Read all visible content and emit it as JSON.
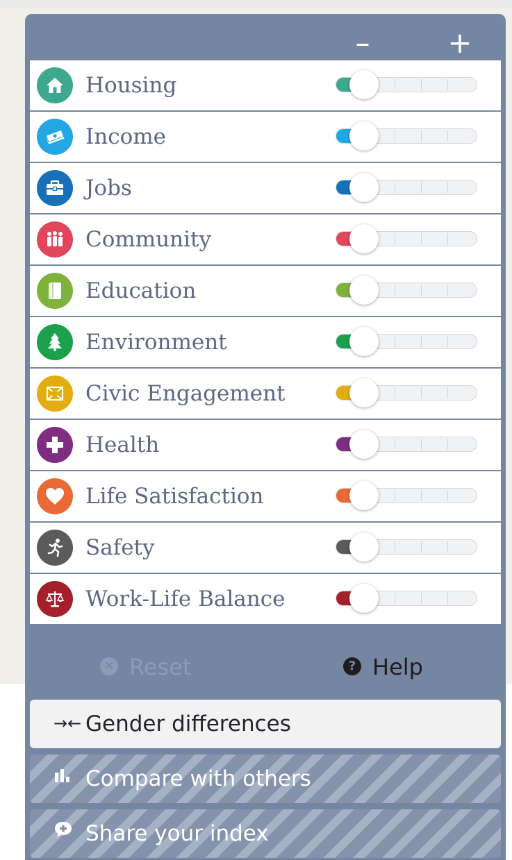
{
  "controls": {
    "minus_label": "–",
    "plus_label": "+"
  },
  "topics": [
    {
      "label": "Housing",
      "color": "#3ea88f",
      "icon": "house-icon",
      "weight": 0
    },
    {
      "label": "Income",
      "color": "#23a6e2",
      "icon": "money-icon",
      "weight": 0
    },
    {
      "label": "Jobs",
      "color": "#1770b8",
      "icon": "briefcase-icon",
      "weight": 0
    },
    {
      "label": "Community",
      "color": "#e1465b",
      "icon": "people-icon",
      "weight": 0
    },
    {
      "label": "Education",
      "color": "#7fb23b",
      "icon": "book-icon",
      "weight": 0
    },
    {
      "label": "Environment",
      "color": "#1ca04b",
      "icon": "tree-icon",
      "weight": 0
    },
    {
      "label": "Civic Engagement",
      "color": "#e3ad10",
      "icon": "ballot-icon",
      "weight": 0
    },
    {
      "label": "Health",
      "color": "#7e2d80",
      "icon": "cross-icon",
      "weight": 0
    },
    {
      "label": "Life Satisfaction",
      "color": "#ea6a35",
      "icon": "heart-icon",
      "weight": 0
    },
    {
      "label": "Safety",
      "color": "#5b5b5b",
      "icon": "runner-icon",
      "weight": 0
    },
    {
      "label": "Work-Life Balance",
      "color": "#a5202b",
      "icon": "scales-icon",
      "weight": 0
    }
  ],
  "actions": {
    "reset_label": "Reset",
    "help_label": "Help"
  },
  "buttons": {
    "gender": "Gender differences",
    "compare": "Compare with others",
    "share": "Share your index"
  }
}
